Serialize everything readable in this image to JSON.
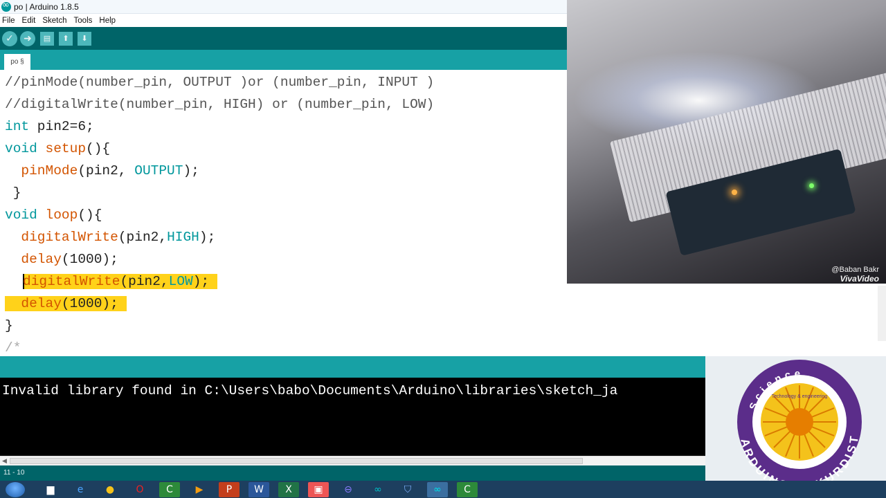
{
  "window": {
    "title": "po | Arduino 1.8.5"
  },
  "menu": [
    "File",
    "Edit",
    "Sketch",
    "Tools",
    "Help"
  ],
  "toolbar": {
    "verify_icon": "check-icon",
    "upload_icon": "arrow-right-icon",
    "new_icon": "file-icon",
    "open_icon": "arrow-up-icon",
    "save_icon": "arrow-down-icon"
  },
  "tab": {
    "label": "po §"
  },
  "code": {
    "l1": "//pinMode(number_pin, OUTPUT )or (number_pin, INPUT )",
    "l2": "//digitalWrite(number_pin, HIGH) or (number_pin, LOW)",
    "l3_type": "int",
    "l3_rest": " pin2=6;",
    "l4_type": "void",
    "l4_fn": "setup",
    "l4_rest": "(){",
    "l5_indent": "  ",
    "l5_fn": "pinMode",
    "l5_mid": "(pin2, ",
    "l5_const": "OUTPUT",
    "l5_end": ");",
    "l6": " }",
    "l7_type": "void",
    "l7_fn": "loop",
    "l7_rest": "(){",
    "l8_indent": "  ",
    "l8_fn": "digitalWrite",
    "l8_mid": "(pin2,",
    "l8_const": "HIGH",
    "l8_end": ");",
    "l9_indent": "  ",
    "l9_fn": "delay",
    "l9_rest": "(1000);",
    "l10_fn": "digitalWrite",
    "l10_mid": "(pin2,",
    "l10_const": "LOW",
    "l10_end": ");",
    "l11_indent": "  ",
    "l11_fn": "delay",
    "l11_rest": "(1000);",
    "l12": "}",
    "l13": "/*"
  },
  "console": {
    "message": "Invalid library found in C:\\Users\\babo\\Documents\\Arduino\\libraries\\sketch_ja"
  },
  "status": {
    "position": "11 - 10"
  },
  "video": {
    "author": "@Baban Bakr",
    "app": "VivaVideo"
  },
  "logo": {
    "top_text": "Science",
    "ring_text": "Technology & engineering",
    "bottom_text": "ARDUINO IN KURDISTAN"
  },
  "colors": {
    "teal_dark": "#006468",
    "teal": "#17a1a5",
    "highlight": "#ffd21a",
    "keyword": "#00979c",
    "function": "#d35400"
  }
}
